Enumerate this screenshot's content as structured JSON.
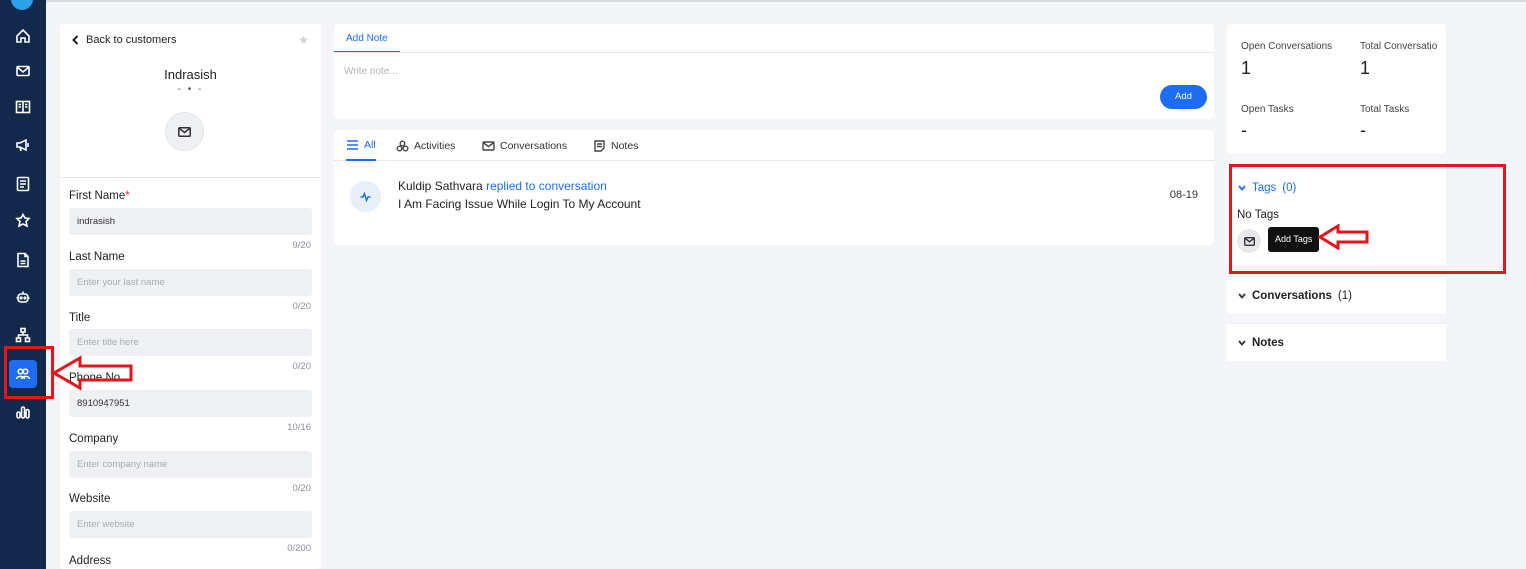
{
  "customer": {
    "back_label": "Back to customers",
    "name": "Indrasish",
    "subtitle": "- • -"
  },
  "form": {
    "first_name": {
      "label": "First Name",
      "required_mark": "*",
      "value": "indrasish",
      "count": "9/20"
    },
    "last_name": {
      "label": "Last Name",
      "placeholder": "Enter your last name",
      "count": "0/20"
    },
    "title": {
      "label": "Title",
      "placeholder": "Enter title here",
      "count": "0/20"
    },
    "phone": {
      "label": "Phone No",
      "value": "8910947951",
      "count": "10/16"
    },
    "company": {
      "label": "Company",
      "placeholder": "Enter company name",
      "count": "0/20"
    },
    "website": {
      "label": "Website",
      "placeholder": "Enter website",
      "count": "0/200"
    },
    "address": {
      "label": "Address"
    }
  },
  "note": {
    "tab": "Add Note",
    "placeholder": "Write note...",
    "add_button": "Add"
  },
  "feed": {
    "tabs": [
      "All",
      "Activities",
      "Conversations",
      "Notes"
    ],
    "activity": {
      "actor": "Kuldip Sathvara",
      "action": "replied to conversation",
      "message": "I Am Facing Issue While Login To My Account",
      "date": "08-19"
    }
  },
  "stats": {
    "open_conversations_label": "Open Conversations",
    "open_conversations_value": "1",
    "total_conversations_label": "Total Conversatio",
    "total_conversations_value": "1",
    "open_tasks_label": "Open Tasks",
    "open_tasks_value": "-",
    "total_tasks_label": "Total Tasks",
    "total_tasks_value": "-"
  },
  "tags": {
    "title": "Tags",
    "count": "(0)",
    "empty_text": "No Tags",
    "tooltip": "Add Tags"
  },
  "sections": {
    "conversations_title": "Conversations",
    "conversations_count": "(1)",
    "notes_title": "Notes"
  },
  "colors": {
    "accent": "#1d6cf2",
    "nav_bg": "#13294b",
    "annotation_red": "#e3161b"
  }
}
